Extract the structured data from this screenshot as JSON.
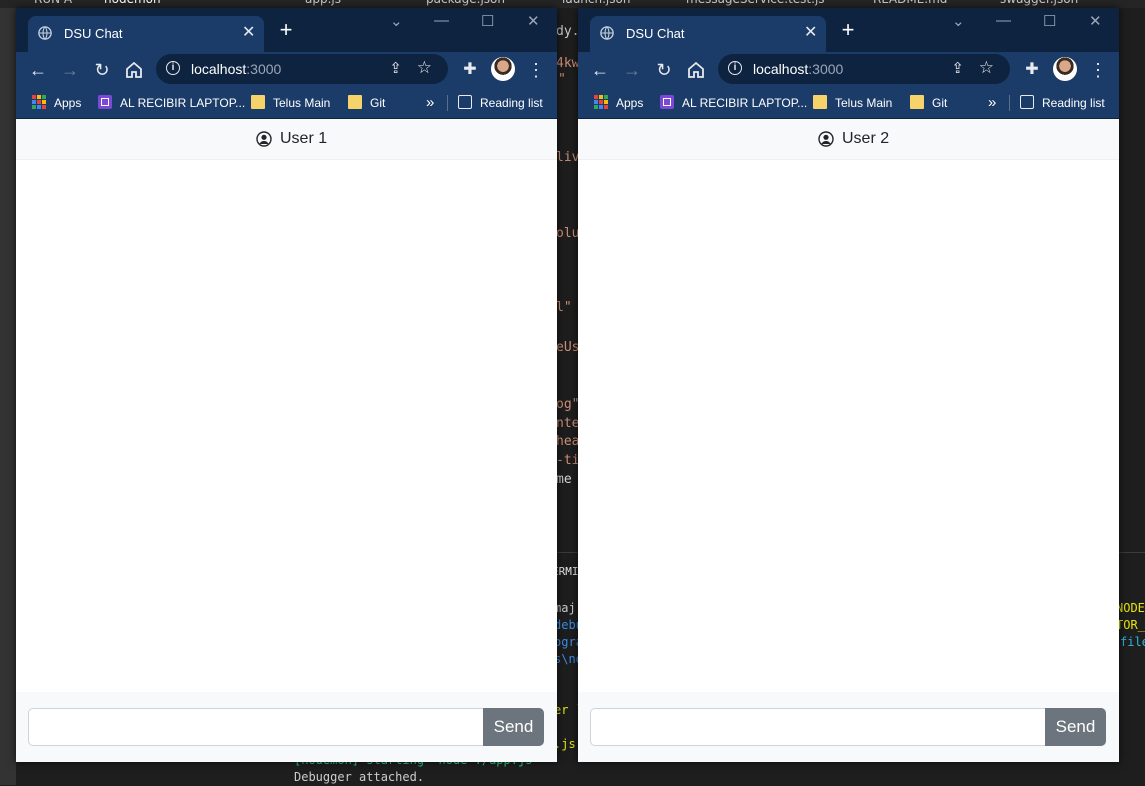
{
  "vscode": {
    "tabs": [
      "RUN A",
      "nodemon",
      "app.js",
      "package.json",
      "launch.json",
      "messageService.test.js",
      "README.md",
      "swagger.json"
    ],
    "code_fragments": [
      "4kw",
      "\"",
      "liv",
      "olu",
      "l\"",
      "eUs",
      "og\"",
      "nte",
      "hea",
      "-ti",
      "me",
      "dy.d"
    ],
    "terminal_tab": "ERMI",
    "terminal_lines": [
      "maj",
      "debu",
      "ogra",
      "s\\no",
      "er `",
      ".js",
      "[nodemon] starting `node ./app.js`",
      "Debugger attached.",
      "NODE_",
      "TOR_O",
      "file"
    ]
  },
  "windows": [
    {
      "tab_title": "DSU Chat",
      "url_host": "localhost",
      "url_port": ":3000",
      "bookmarks": [
        "Apps",
        "AL RECIBIR LAPTOP...",
        "Telus Main",
        "Git"
      ],
      "reading_list": "Reading list",
      "overflow": "»",
      "user_label": "User 1",
      "message_placeholder": "",
      "send_label": "Send"
    },
    {
      "tab_title": "DSU Chat",
      "url_host": "localhost",
      "url_port": ":3000",
      "bookmarks": [
        "Apps",
        "AL RECIBIR LAPTOP...",
        "Telus Main",
        "Git"
      ],
      "reading_list": "Reading list",
      "overflow": "»",
      "user_label": "User 2",
      "message_placeholder": "",
      "send_label": "Send"
    }
  ],
  "colors": {
    "chrome_frame": "#0e2340",
    "chrome_toolbar": "#1b3c69",
    "send_button": "#6c757d",
    "header_bg": "#f8f9fa"
  }
}
